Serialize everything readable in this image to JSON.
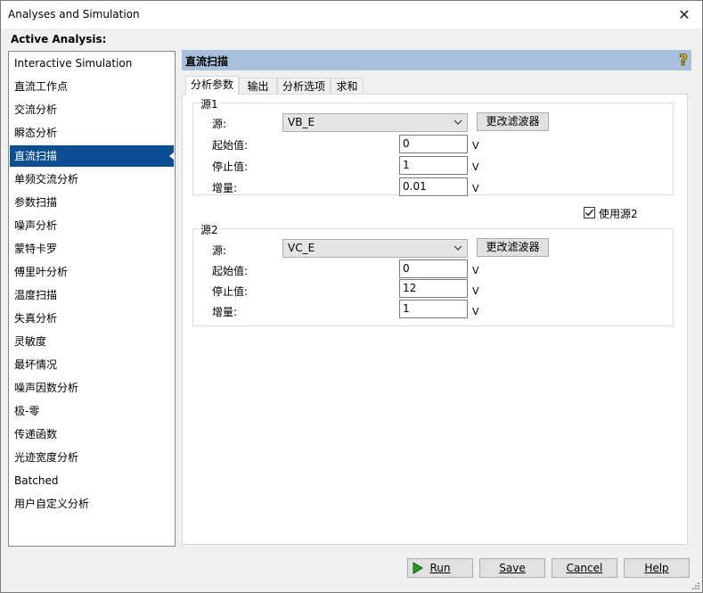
{
  "window": {
    "title": "Analyses and Simulation",
    "close_glyph": "✕"
  },
  "active_analysis_label": "Active Analysis:",
  "analyses": [
    "Interactive Simulation",
    "直流工作点",
    "交流分析",
    "瞬态分析",
    "直流扫描",
    "单频交流分析",
    "参数扫描",
    "噪声分析",
    "蒙特卡罗",
    "傅里叶分析",
    "温度扫描",
    "失真分析",
    "灵敏度",
    "最坏情况",
    "噪声因数分析",
    "极-零",
    "传递函数",
    "光迹宽度分析",
    "Batched",
    "用户自定义分析"
  ],
  "selected_analysis": "直流扫描",
  "panel": {
    "title": "直流扫描",
    "help_icon": "question-mark-icon",
    "header_color": "#a8c0dc",
    "tabs": [
      "分析参数",
      "输出",
      "分析选项",
      "求和"
    ],
    "active_tab": "分析参数"
  },
  "source1": {
    "group_label": "源1",
    "source_label": "源:",
    "source_value": "VB_E",
    "change_filter_label": "更改滤波器",
    "start_label": "起始值:",
    "start_value": "0",
    "stop_label": "停止值:",
    "stop_value": "1",
    "increment_label": "增量:",
    "increment_value": "0.01",
    "unit": "V"
  },
  "use_source2": {
    "label": "使用源2",
    "checked": true
  },
  "source2": {
    "group_label": "源2",
    "source_label": "源:",
    "source_value": "VC_E",
    "change_filter_label": "更改滤波器",
    "start_label": "起始值:",
    "start_value": "0",
    "stop_label": "停止值:",
    "stop_value": "12",
    "increment_label": "增量:",
    "increment_value": "1",
    "unit": "V"
  },
  "footer": {
    "run": "Run",
    "save": "Save",
    "cancel": "Cancel",
    "help": "Help",
    "run_icon_color": "#1aa31a"
  },
  "colors": {
    "selection": "#0b4e94",
    "accent_blue": "#0b4e94"
  }
}
